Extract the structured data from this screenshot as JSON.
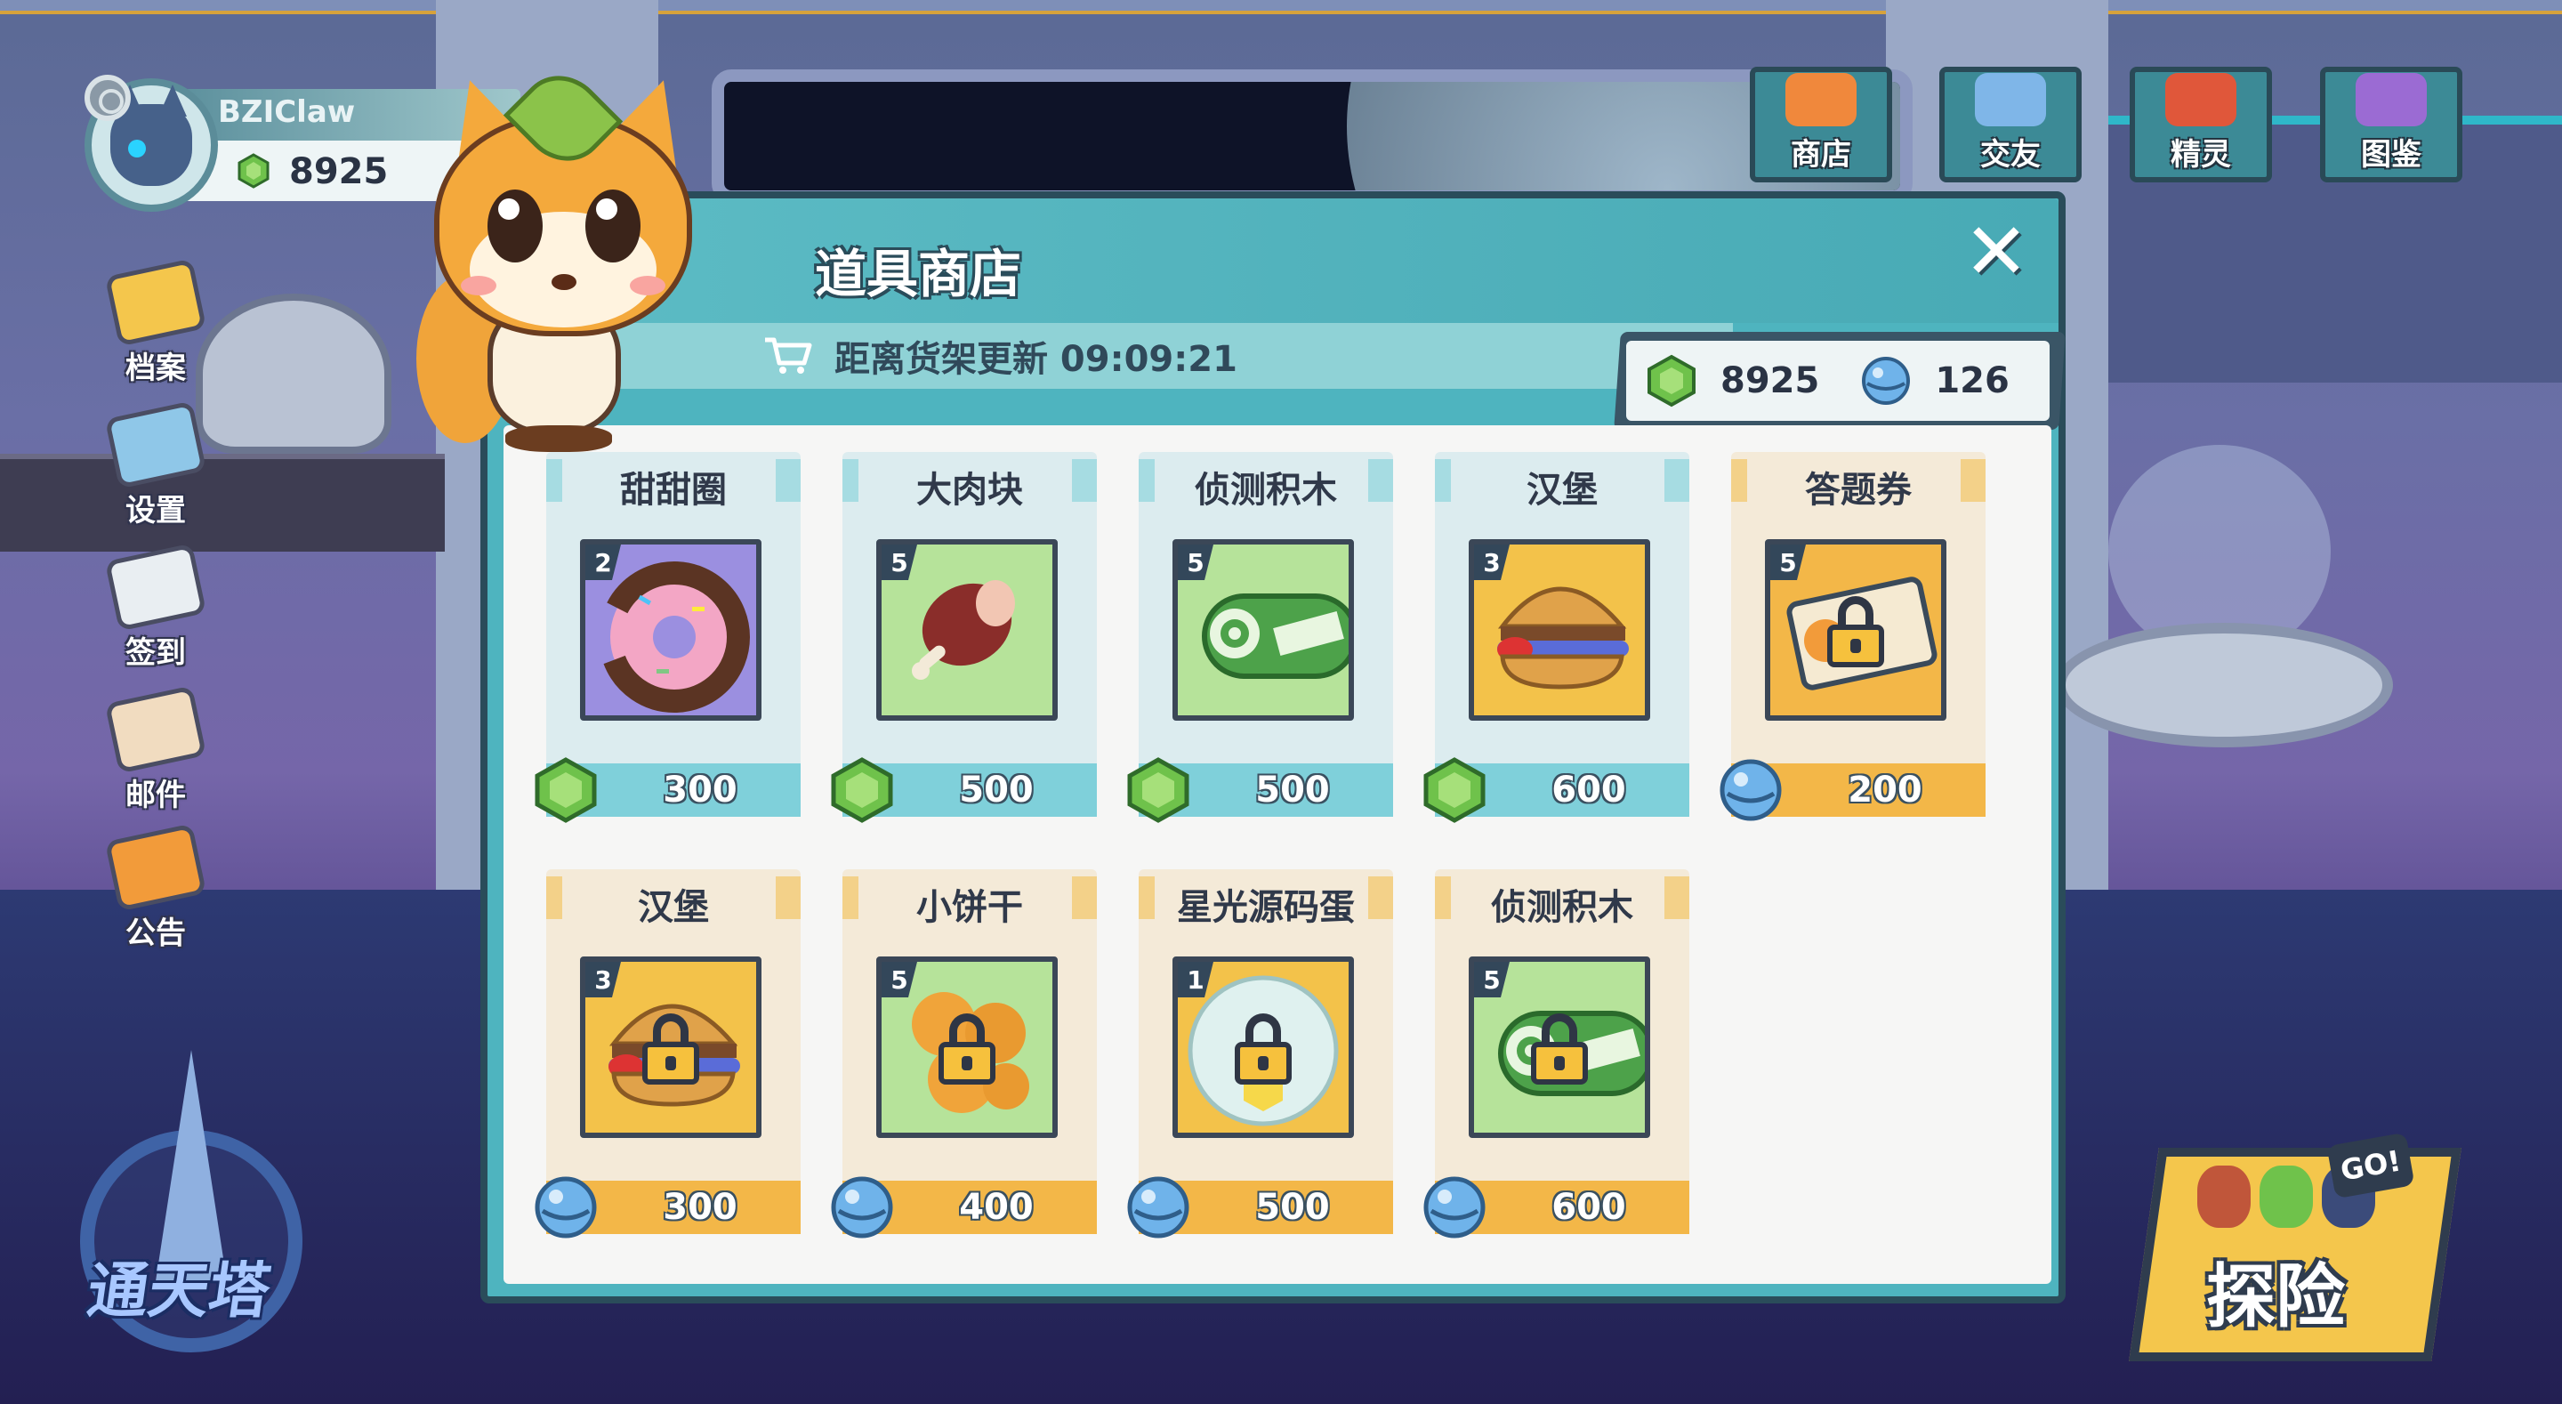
{
  "player": {
    "name": "BZIClaw",
    "gems": "8925"
  },
  "side_menu": [
    {
      "label": "档案",
      "icon": "profile-card-icon",
      "color": "#f4c64c"
    },
    {
      "label": "设置",
      "icon": "settings-board-icon",
      "color": "#8fc7e8"
    },
    {
      "label": "签到",
      "icon": "calendar-check-icon",
      "color": "#e9eef2"
    },
    {
      "label": "邮件",
      "icon": "mail-envelope-icon",
      "color": "#f1dcc0"
    },
    {
      "label": "公告",
      "icon": "megaphone-icon",
      "color": "#f29b3a"
    }
  ],
  "top_nav": [
    {
      "label": "商店",
      "icon": "shop-icon",
      "color": "#f0883c"
    },
    {
      "label": "交友",
      "icon": "chat-bubble-icon",
      "color": "#7fb6e8"
    },
    {
      "label": "精灵",
      "icon": "sprite-cat-icon",
      "color": "#e0573a"
    },
    {
      "label": "图鉴",
      "icon": "book-icon",
      "color": "#9b6bd3"
    }
  ],
  "tower": {
    "label": "通天塔"
  },
  "explore": {
    "label": "探险",
    "go": "GO!"
  },
  "shop": {
    "title": "道具商店",
    "close": "✕",
    "refresh_text": "距离货架更新 09:09:21",
    "currency": {
      "gems": "8925",
      "balls": "126"
    },
    "items": [
      {
        "name": "甜甜圈",
        "qty": "2",
        "price": "300",
        "currency": "gem",
        "locked": false,
        "art": "donut"
      },
      {
        "name": "大肉块",
        "qty": "5",
        "price": "500",
        "currency": "gem",
        "locked": false,
        "art": "meat"
      },
      {
        "name": "侦测积木",
        "qty": "5",
        "price": "500",
        "currency": "gem",
        "locked": false,
        "art": "sensor"
      },
      {
        "name": "汉堡",
        "qty": "3",
        "price": "600",
        "currency": "gem",
        "locked": false,
        "art": "burger"
      },
      {
        "name": "答题券",
        "qty": "5",
        "price": "200",
        "currency": "ball",
        "locked": true,
        "art": "ticket"
      },
      {
        "name": "汉堡",
        "qty": "3",
        "price": "300",
        "currency": "ball",
        "locked": true,
        "art": "burger"
      },
      {
        "name": "小饼干",
        "qty": "5",
        "price": "400",
        "currency": "ball",
        "locked": true,
        "art": "cookie"
      },
      {
        "name": "星光源码蛋",
        "qty": "1",
        "price": "500",
        "currency": "ball",
        "locked": true,
        "art": "egg"
      },
      {
        "name": "侦测积木",
        "qty": "5",
        "price": "600",
        "currency": "ball",
        "locked": true,
        "art": "sensor"
      }
    ]
  },
  "colors": {
    "teal": "#4eb4bf",
    "gem_bar": "#7fd0da",
    "ball_bar": "#f3b748",
    "outline": "#2a4c5a"
  }
}
